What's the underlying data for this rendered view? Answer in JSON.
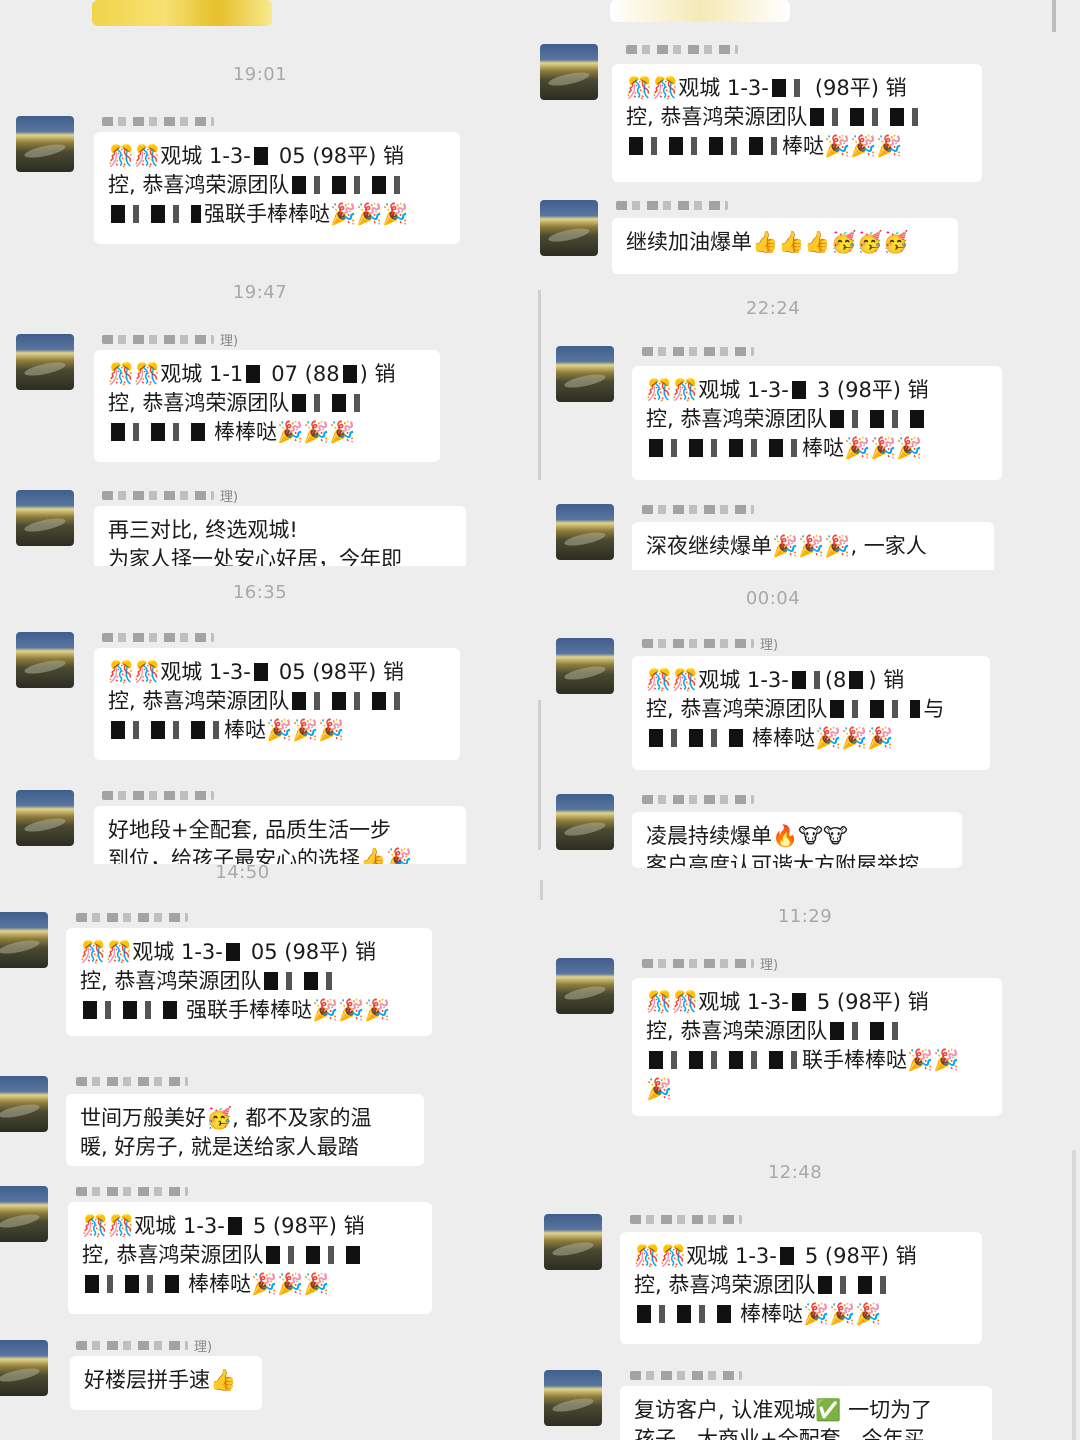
{
  "left": {
    "ts1": "19:01",
    "ts2": "19:47",
    "ts3": "16:35",
    "ts4": "14:50",
    "m1": [
      "🎊🎊观城 1-3-",
      "05 (98平) 销",
      "控, 恭喜鸿荣源团队",
      "强联手棒棒哒🎉🎉🎉"
    ],
    "m2": [
      "🎊🎊观城 1-1",
      "07 (88",
      ") 销",
      "控, 恭喜鸿荣源团队",
      "棒棒哒🎉🎉🎉"
    ],
    "nick2": "理)",
    "nick3": "理)",
    "m3": [
      "再三对比, 终选观城!",
      "为家人择一处安心好居，今年即"
    ],
    "m4": [
      "🎊🎊观城 1-3-",
      "05 (98平) 销",
      "控, 恭喜鸿荣源团队",
      "棒哒🎉🎉🎉"
    ],
    "m5": [
      "好地段+全配套, 品质生活一步",
      "到位，给孩子最安心的选择👍🎉"
    ],
    "m6": [
      "🎊🎊观城 1-3-",
      "05 (98平) 销",
      "控, 恭喜鸿荣源团队",
      "强联手棒棒哒🎉🎉🎉"
    ],
    "m7": [
      "世间万般美好🥳, 都不及家的温",
      "暖, 好房子, 就是送给家人最踏"
    ],
    "m8": [
      "🎊🎊观城 1-3-",
      "5 (98平) 销",
      "控, 恭喜鸿荣源团队",
      "棒棒哒🎉🎉🎉"
    ],
    "nick9": "理)",
    "m9": [
      "好楼层拼手速👍"
    ]
  },
  "right": {
    "ts1": "22:24",
    "ts2": "00:04",
    "ts3": "11:29",
    "ts4": "12:48",
    "r1": [
      "🎊🎊观城 1-3-",
      "(98平) 销",
      "控, 恭喜鸿荣源团队",
      "棒哒🎉🎉🎉"
    ],
    "r2": [
      "继续加油爆单👍👍👍🥳🥳🥳"
    ],
    "r3": [
      "🎊🎊观城 1-3-",
      "3 (98平) 销",
      "控, 恭喜鸿荣源团队",
      "棒哒🎉🎉🎉"
    ],
    "r4": [
      "深夜继续爆单🎉🎉🎉, 一家人"
    ],
    "nick5": "理)",
    "r5": [
      "🎊🎊观城 1-3-",
      "(8",
      ") 销",
      "控, 恭喜鸿荣源团队",
      "与",
      "棒棒哒🎉🎉🎉"
    ],
    "r6": [
      "凌晨持续爆单🔥🐮🐮",
      "客户高度认可谐大方附屋举控"
    ],
    "nick7": "理)",
    "r7": [
      "🎊🎊观城 1-3-",
      "5 (98平) 销",
      "控, 恭喜鸿荣源团队",
      "联手棒棒哒🎉🎉",
      "🎉"
    ],
    "r8": [
      "🎊🎊观城 1-3-",
      "5 (98平) 销",
      "控, 恭喜鸿荣源团队",
      "棒棒哒🎉🎉🎉"
    ],
    "r9": [
      "复访客户, 认准观城✅ 一切为了",
      "孩子，大商业+全配套，今年买"
    ]
  },
  "colors": {
    "background": "#ededed",
    "bubble": "#ffffff",
    "timestamp": "#a9a9a9"
  }
}
